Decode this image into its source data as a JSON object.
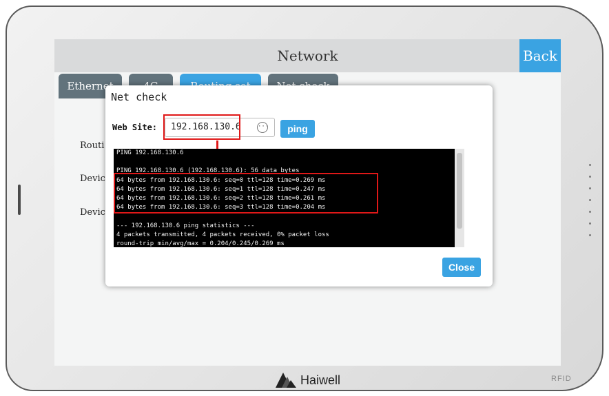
{
  "screen": {
    "title": "Network",
    "back_label": "Back",
    "tabs": [
      "Ethernet",
      "4G",
      "Routing set",
      "Net check"
    ],
    "labels": [
      "Routi",
      "Devic",
      "Devic"
    ]
  },
  "dialog": {
    "title": "Net check",
    "web_site_label": "Web Site:",
    "web_site_value": "192.168.130.6",
    "ping_label": "ping",
    "close_label": "Close",
    "console_lines": [
      "PING 192.168.130.6",
      "",
      "PING 192.168.130.6 (192.168.130.6): 56 data bytes",
      "64 bytes from 192.168.130.6: seq=0 ttl=128 time=0.269 ms",
      "64 bytes from 192.168.130.6: seq=1 ttl=128 time=0.247 ms",
      "64 bytes from 192.168.130.6: seq=2 ttl=128 time=0.261 ms",
      "64 bytes from 192.168.130.6: seq=3 ttl=128 time=0.204 ms",
      "",
      "--- 192.168.130.6 ping statistics ---",
      "4 packets transmitted, 4 packets received, 0% packet loss",
      "round-trip min/avg/max = 0.204/0.245/0.269 ms"
    ]
  },
  "device": {
    "brand": "Haiwell",
    "rfid_label": "RFID"
  },
  "colors": {
    "accent": "#3aa3e2",
    "tab_inactive": "#62737c",
    "highlight": "#e01818"
  }
}
